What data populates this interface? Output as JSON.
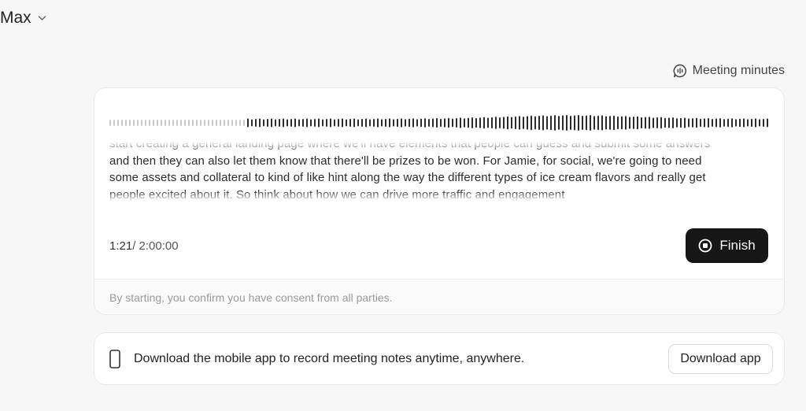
{
  "header": {
    "model_name": "Max"
  },
  "meeting_minutes": {
    "label": "Meeting minutes"
  },
  "recorder": {
    "transcript_lines": [
      "start creating a general landing page where we'll have elements that people can guess and submit some answers",
      "and then they can also let them know that there'll be prizes to be won. For Jamie, for social, we're going to need",
      "some assets and collateral to kind of like hint along the way the different types of ice cream flavors and really get",
      "people excited about it. So think about how we can drive more traffic and engagement"
    ],
    "elapsed": "1:21",
    "total": "/ 2:00:00",
    "finish_label": "Finish",
    "consent_text": "By starting, you confirm you have consent from all parties."
  },
  "download": {
    "message": "Download the mobile app to record meeting notes anytime, anywhere.",
    "button_label": "Download app"
  },
  "colors": {
    "background": "#f7f7f7",
    "button_dark": "#161616",
    "wave_active": "#2a2a2a",
    "wave_inactive": "#c9c9c9"
  }
}
